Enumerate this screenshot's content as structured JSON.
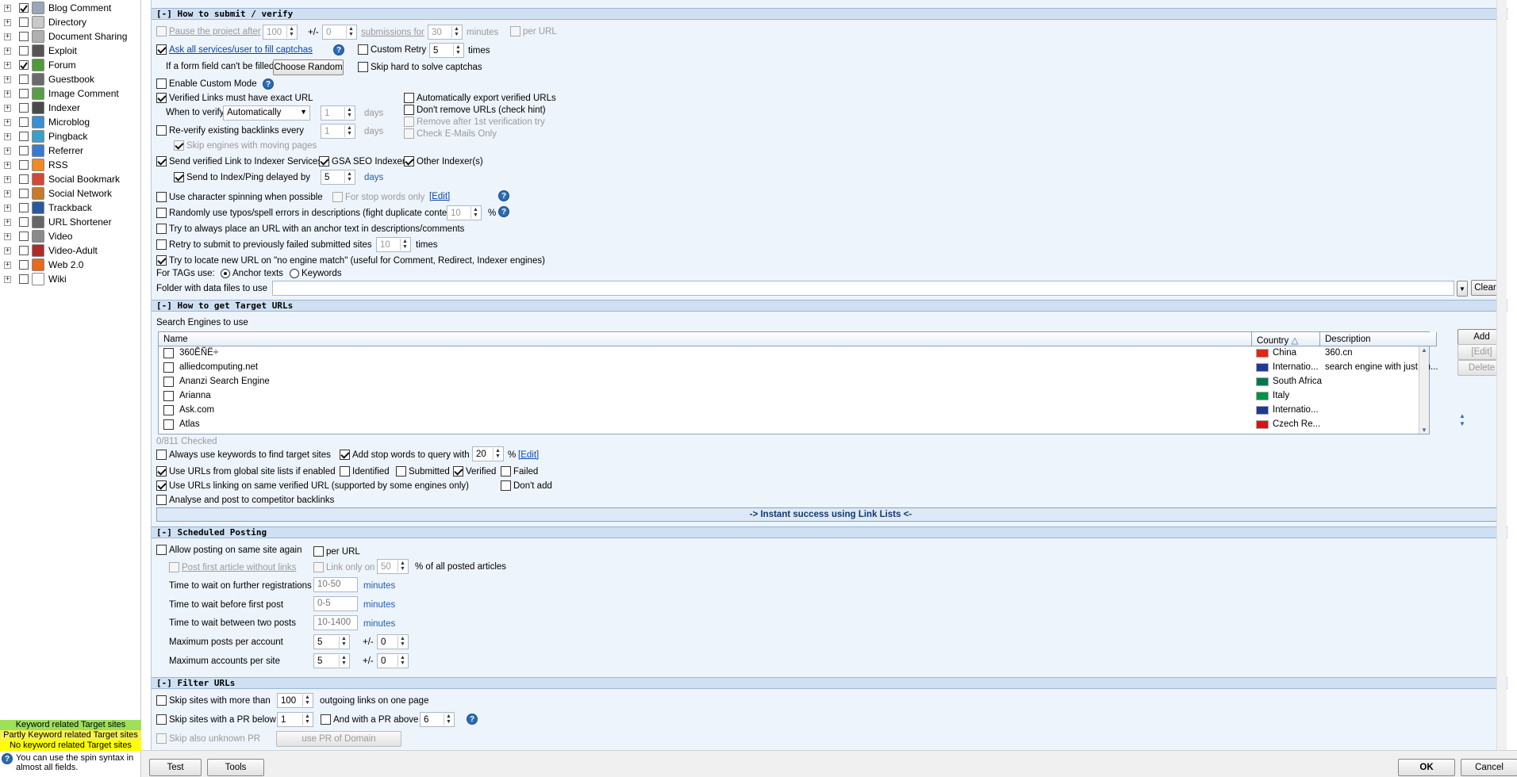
{
  "sidebar": {
    "items": [
      {
        "label": "Blog Comment",
        "checked": true,
        "icon": "blog-comment-icon",
        "color": "#9aa7b8"
      },
      {
        "label": "Directory",
        "checked": false,
        "icon": "directory-icon",
        "color": "#c9c9c9"
      },
      {
        "label": "Document Sharing",
        "checked": false,
        "icon": "document-icon",
        "color": "#b0b0b0"
      },
      {
        "label": "Exploit",
        "checked": false,
        "icon": "exploit-icon",
        "color": "#555555"
      },
      {
        "label": "Forum",
        "checked": true,
        "icon": "forum-icon",
        "color": "#4f9a3a"
      },
      {
        "label": "Guestbook",
        "checked": false,
        "icon": "guestbook-icon",
        "color": "#6b6b6b"
      },
      {
        "label": "Image Comment",
        "checked": false,
        "icon": "image-icon",
        "color": "#5a9c4a"
      },
      {
        "label": "Indexer",
        "checked": false,
        "icon": "indexer-icon",
        "color": "#4a4a4a"
      },
      {
        "label": "Microblog",
        "checked": false,
        "icon": "microblog-icon",
        "color": "#3a8fd0"
      },
      {
        "label": "Pingback",
        "checked": false,
        "icon": "pingback-icon",
        "color": "#3aa0c8"
      },
      {
        "label": "Referrer",
        "checked": false,
        "icon": "referrer-icon",
        "color": "#3a7bd0"
      },
      {
        "label": "RSS",
        "checked": false,
        "icon": "rss-icon",
        "color": "#f08a24"
      },
      {
        "label": "Social Bookmark",
        "checked": false,
        "icon": "bookmark-icon",
        "color": "#d04a3a"
      },
      {
        "label": "Social Network",
        "checked": false,
        "icon": "network-icon",
        "color": "#c87a2a"
      },
      {
        "label": "Trackback",
        "checked": false,
        "icon": "trackback-icon",
        "color": "#2a5a9a"
      },
      {
        "label": "URL Shortener",
        "checked": false,
        "icon": "shortener-icon",
        "color": "#666666"
      },
      {
        "label": "Video",
        "checked": false,
        "icon": "video-icon",
        "color": "#8a8a8a"
      },
      {
        "label": "Video-Adult",
        "checked": false,
        "icon": "video-adult-icon",
        "color": "#b02a2a"
      },
      {
        "label": "Web 2.0",
        "checked": false,
        "icon": "web20-icon",
        "color": "#e86a1a"
      },
      {
        "label": "Wiki",
        "checked": false,
        "icon": "wiki-icon",
        "color": "#ffffff"
      }
    ],
    "legend": [
      {
        "text": "Keyword related Target sites",
        "color": "#9fe05a"
      },
      {
        "text": "Partly Keyword related Target sites",
        "color": "#f6f24a"
      },
      {
        "text": "No keyword related Target sites",
        "color": "#ffff00"
      }
    ],
    "hint": "You can use the spin syntax in almost all fields."
  },
  "s1": {
    "header": "[-] How to submit / verify",
    "pause_label": "Pause the project after",
    "pause_val": "100",
    "pm": "+/-",
    "pause_pm": "0",
    "submissions_label": "submissions for",
    "pause_min": "30",
    "minutes": "minutes",
    "per_url": "per URL",
    "ask_captcha": "Ask all services/user to fill captchas",
    "custom_retry": "Custom Retry",
    "retry_val": "5",
    "times": "times",
    "form_field": "If a form field can't be filled",
    "choose_random": "Choose Random",
    "skip_hard": "Skip hard to solve captchas",
    "enable_custom": "Enable Custom Mode",
    "verified_exact": "Verified Links must have exact URL",
    "auto_export": "Automatically export verified URLs",
    "dont_remove": "Don't remove URLs (check hint)",
    "remove_after": "Remove after 1st verification try",
    "check_emails": "Check E-Mails Only",
    "when_verify": "When to verify",
    "when_val": "Automatically",
    "when_num": "1",
    "days": "days",
    "reverify": "Re-verify existing backlinks every",
    "reverify_num": "1",
    "skip_moving": "Skip engines with moving pages",
    "send_indexer": "Send verified Link to Indexer Services",
    "gsa_indexer": "GSA SEO Indexer",
    "other_indexer": "Other Indexer(s)",
    "send_ping": "Send to Index/Ping delayed by",
    "ping_val": "5",
    "char_spin": "Use character spinning when possible",
    "stop_words_only": "For stop words only",
    "edit": "[Edit]",
    "typos": "Randomly use typos/spell errors in descriptions (fight duplicate content)",
    "typos_val": "10",
    "pct": "%",
    "anchor": "Try to always place an URL with an anchor text in descriptions/comments",
    "retry_failed": "Retry to submit to previously failed submitted sites",
    "retry_failed_val": "10",
    "locate_new": "Try to locate new URL on \"no engine match\" (useful for Comment, Redirect, Indexer engines)",
    "for_tags": "For TAGs use:",
    "anchor_texts": "Anchor texts",
    "keywords": "Keywords",
    "folder": "Folder with data files to use",
    "clear": "Clear"
  },
  "s2": {
    "header": "[-] How to get Target URLs",
    "se_label": "Search Engines to use",
    "cols": {
      "name": "Name",
      "country": "Country",
      "desc": "Description"
    },
    "rows": [
      {
        "name": "360ÊÑË÷",
        "country": "China",
        "desc": "360.cn",
        "flag": "#de2910"
      },
      {
        "name": "alliedcomputing.net",
        "country": "Internatio...",
        "desc": "search engine with just on...",
        "flag": "#1f3a93"
      },
      {
        "name": "Ananzi Search Engine",
        "country": "South Africa",
        "desc": "",
        "flag": "#007a4d"
      },
      {
        "name": "Arianna",
        "country": "Italy",
        "desc": "",
        "flag": "#009246"
      },
      {
        "name": "Ask.com",
        "country": "Internatio...",
        "desc": "",
        "flag": "#1f3a93"
      },
      {
        "name": "Atlas",
        "country": "Czech Re...",
        "desc": "",
        "flag": "#d7141a"
      }
    ],
    "add": "Add",
    "edit": "[Edit]",
    "delete": "Delete",
    "checked_count": "0/811 Checked",
    "always_kw": "Always use keywords to find target sites",
    "add_stop": "Add stop words to query with",
    "stop_val": "20",
    "pct": "%",
    "use_global": "Use URLs from global site lists if enabled",
    "identified": "Identified",
    "submitted": "Submitted",
    "verified": "Verified",
    "failed": "Failed",
    "use_linking": "Use URLs linking on same verified URL (supported by some engines only)",
    "dont_add": "Don't add",
    "analyse": "Analyse and post to competitor backlinks",
    "banner": "-> Instant success using Link Lists <-"
  },
  "s3": {
    "header": "[-] Scheduled Posting",
    "allow": "Allow posting on same site again",
    "per_url": "per URL",
    "post_first": "Post first article without links",
    "link_only": "Link only on",
    "link_val": "50",
    "pct_all": "% of all posted articles",
    "wait_reg": "Time to wait on further registrations",
    "wait_reg_val": "10-50",
    "minutes": "minutes",
    "wait_first": "Time to wait before first post",
    "wait_first_val": "0-5",
    "wait_two": "Time to wait between two posts",
    "wait_two_val": "10-1400",
    "max_posts": "Maximum posts per account",
    "max_posts_val": "5",
    "pm": "+/-",
    "max_posts_pm": "0",
    "max_acc": "Maximum accounts per site",
    "max_acc_val": "5",
    "max_acc_pm": "0"
  },
  "s4": {
    "header": "[-] Filter URLs",
    "skip_more": "Skip sites with more than",
    "skip_more_val": "100",
    "outgoing": "outgoing links on one page",
    "skip_pr": "Skip sites with a PR below",
    "pr_below_val": "1",
    "and_pr": "And with a PR above",
    "pr_above_val": "6",
    "skip_unknown": "Skip also unknown PR",
    "use_pr": "use PR of Domain"
  },
  "footer": {
    "test": "Test",
    "tools": "Tools",
    "ok": "OK",
    "cancel": "Cancel"
  }
}
